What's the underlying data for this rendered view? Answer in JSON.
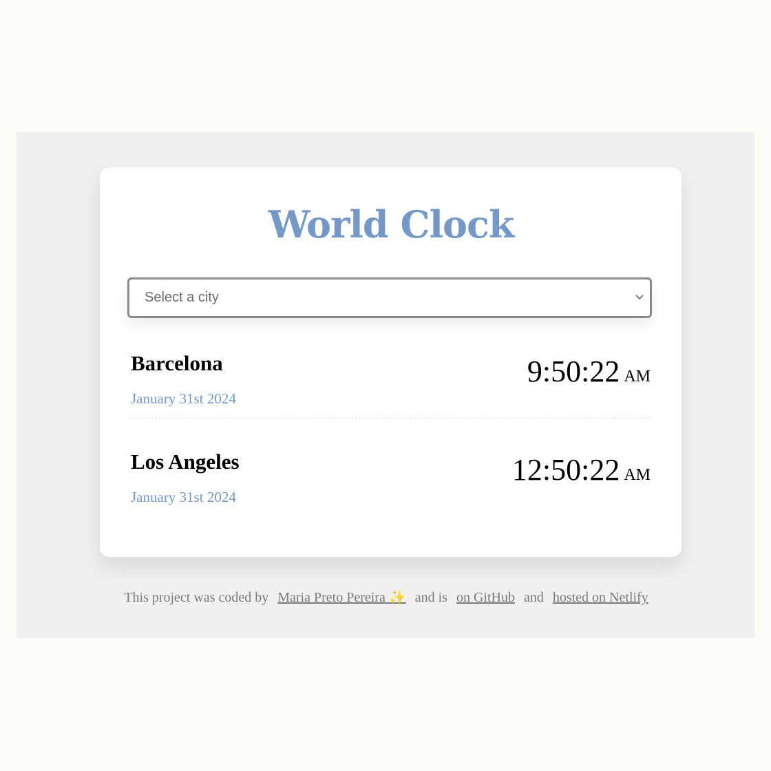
{
  "app": {
    "title": "World Clock"
  },
  "city_select": {
    "selected_label": "Select a city"
  },
  "cities": [
    {
      "name": "Barcelona",
      "date": "January 31st 2024",
      "time": "9:50:22",
      "period": "AM"
    },
    {
      "name": "Los Angeles",
      "date": "January 31st 2024",
      "time": "12:50:22",
      "period": "AM"
    }
  ],
  "footer": {
    "prefix": "This project was coded by",
    "author_link": "Maria Preto Pereira",
    "author_emoji": "✨",
    "middle_1": "and is",
    "github_link": "on GitHub",
    "middle_2": "and",
    "netlify_link": "hosted on Netlify"
  },
  "colors": {
    "page_background": "#fdfcf6",
    "band_background": "#f0f0f0",
    "accent": "#7499c9",
    "muted_text": "#7a7a7a"
  },
  "icons": {
    "select_chevron": "chevron-down-icon"
  }
}
